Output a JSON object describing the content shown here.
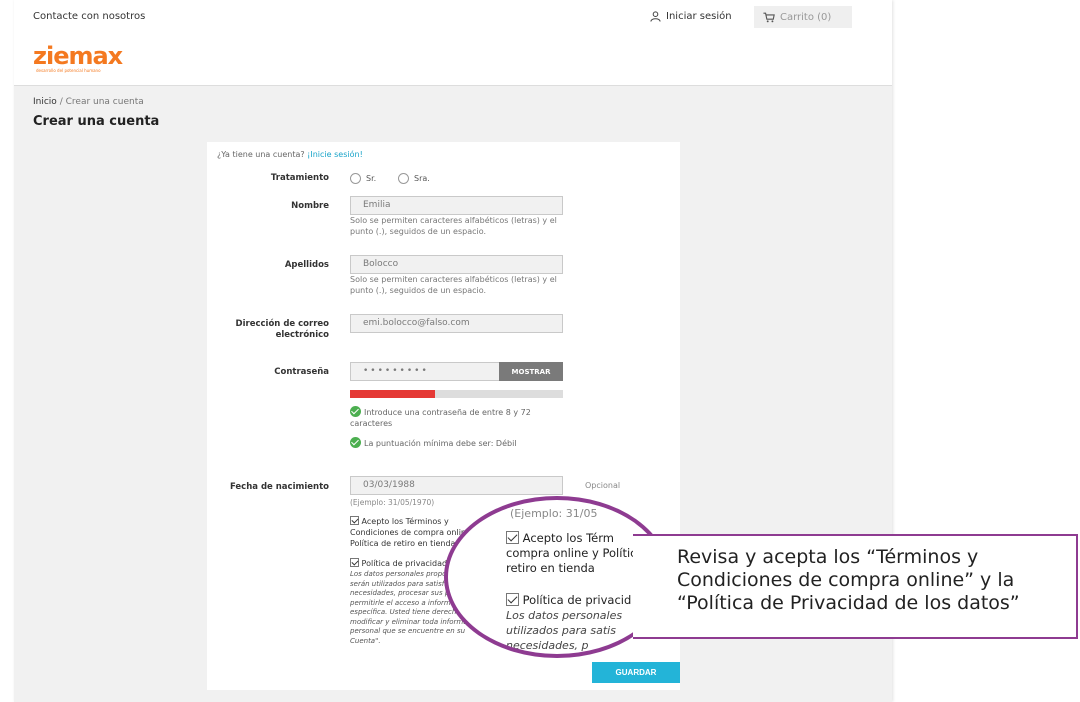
{
  "header": {
    "contact_link": "Contacte con nosotros",
    "login_link": "Iniciar sesión",
    "cart_label": "Carrito (0)",
    "logo_text": "ziemax",
    "logo_tagline": "desarrollo del potencial humano",
    "brand_color": "#f47920"
  },
  "breadcrumb": {
    "home": "Inicio",
    "separator": "/",
    "current": "Crear una cuenta"
  },
  "page_title": "Crear una cuenta",
  "form": {
    "have_account_text": "¿Ya tiene una cuenta?",
    "have_account_link": "¡Inicie sesión!",
    "title_label": "Tratamiento",
    "title_options": [
      "Sr.",
      "Sra."
    ],
    "first_name_label": "Nombre",
    "first_name_value": "Emilia",
    "name_help": "Solo se permiten caracteres alfabéticos (letras) y el punto (.), seguidos de un espacio.",
    "last_name_label": "Apellidos",
    "last_name_value": "Bolocco",
    "email_label": "Dirección de correo electrónico",
    "email_value": "emi.bolocco@falso.com",
    "password_label": "Contraseña",
    "password_value": "•••••••••",
    "show_button": "MOSTRAR",
    "password_strength": 0.4,
    "check_length": "Introduce una contraseña de entre 8 y 72 caracteres",
    "check_score": "La puntuación mínima debe ser: Débil",
    "birthdate_label": "Fecha de nacimiento",
    "birthdate_value": "03/03/1988",
    "optional": "Opcional",
    "example": "(Ejemplo: 31/05/1970)",
    "terms_text": "Acepto los Términos y Condiciones de compra online y Política de retiro en tienda",
    "privacy_title": "Política de privacidad",
    "privacy_text": "Los datos personales proporcionados serán utilizados para satisfacer sus necesidades, procesar sus pedidos y permitirle el acceso a información específica. Usted tiene derecho a modificar y eliminar toda información personal que se encuentre en su Cuenta\".",
    "save_button": "GUARDAR"
  },
  "zoom": {
    "example": "(Ejemplo: 31/05",
    "terms_line1": "Acepto los Térm",
    "terms_line2": "compra online y Polític",
    "terms_line3": "retiro en tienda",
    "privacy_title": "Política de privacid",
    "privacy_line1": "Los datos personales",
    "privacy_line2": "utilizados para satis",
    "privacy_line3": "necesidades, p",
    "privacy_line4": "permitirle",
    "accent_color": "#8e3b91"
  },
  "callout": {
    "text": "Revisa y acepta los “Términos y Condiciones de compra online” y la “Política de Privacidad de los datos”"
  }
}
